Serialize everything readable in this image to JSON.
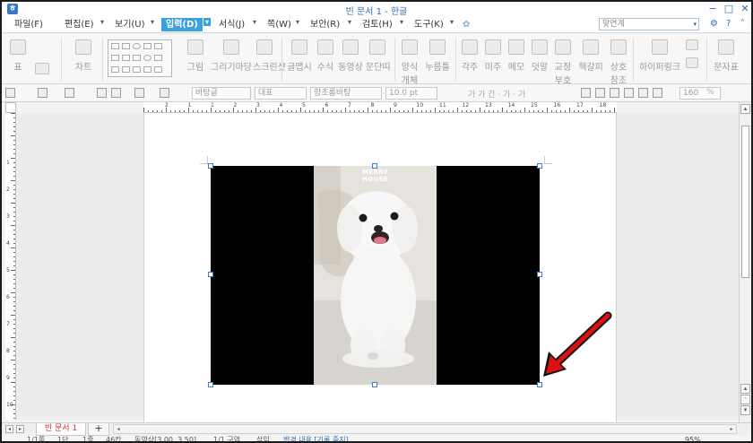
{
  "window": {
    "title": "빈 문서 1 - 한글"
  },
  "menu": {
    "items": [
      "파일(F)",
      "편집(E)",
      "보기(U)",
      "입력(D)",
      "서식(J)",
      "쪽(W)",
      "보안(R)",
      "검토(H)",
      "도구(K)"
    ],
    "active_index": 3,
    "search_value": "맞연계",
    "right_icons": [
      "settings-icon",
      "help-icon"
    ]
  },
  "ribbon": {
    "table_label": "표",
    "chart_label": "차트",
    "picture_label": "그림",
    "drawing_label": "그리기마당",
    "screenshot_label": "스크린샷",
    "text_art_label": "글맵시",
    "formula_label": "수식",
    "video_label": "동영상",
    "paragraph_label": "문단띠",
    "object_label_1": "양식",
    "object_label_2": "개체",
    "button_label": "누름틀",
    "footnote_label": "각주",
    "endnote_label": "미주",
    "memo_label": "메모",
    "comment_label": "덧말",
    "proof_label_1": "교정",
    "proof_label_2": "부호",
    "bookmark_label": "책갈피",
    "crossref_label_1": "상호",
    "crossref_label_2": "참조",
    "hyperlink_label": "하이퍼링크",
    "symbol_label": "문자표"
  },
  "format_toolbar": {
    "style_value": "바탕글",
    "lang_value": "대표",
    "font_value": "함초롬바탕",
    "size_value": "10.0",
    "size_unit": "pt",
    "bold_chars": "가 가 간 · 가 · 가",
    "zoom_value": "160",
    "zoom_unit": "%"
  },
  "ruler": {
    "h_numbers": [
      "2",
      "1",
      "1",
      "2",
      "3",
      "4",
      "5",
      "6",
      "7",
      "8",
      "9",
      "10",
      "11",
      "12",
      "13",
      "14",
      "15",
      "16",
      "17",
      "18"
    ],
    "v_numbers": [
      "1",
      "2",
      "3",
      "4",
      "5",
      "6",
      "7",
      "8",
      "9",
      "10"
    ]
  },
  "image": {
    "watermark_line1": "MERRY",
    "watermark_line2": "HOUSE"
  },
  "tabs": {
    "document_tab": "빈 문서 1",
    "add_tab": "+"
  },
  "status": {
    "page": "1/1쪽",
    "section": "1단",
    "line": "1줄",
    "column": "46칸",
    "object": "동영상[3.00, 3.50]",
    "section2": "1/1 구역",
    "mode": "삽입",
    "track": "변경 내용 [기록 중지]",
    "zoom": "95%"
  },
  "colors": {
    "accent": "#3aa0e0",
    "title_blue": "#2a6fb5",
    "arrow_red": "#dd1111",
    "handle_blue": "#3a7ed4"
  }
}
